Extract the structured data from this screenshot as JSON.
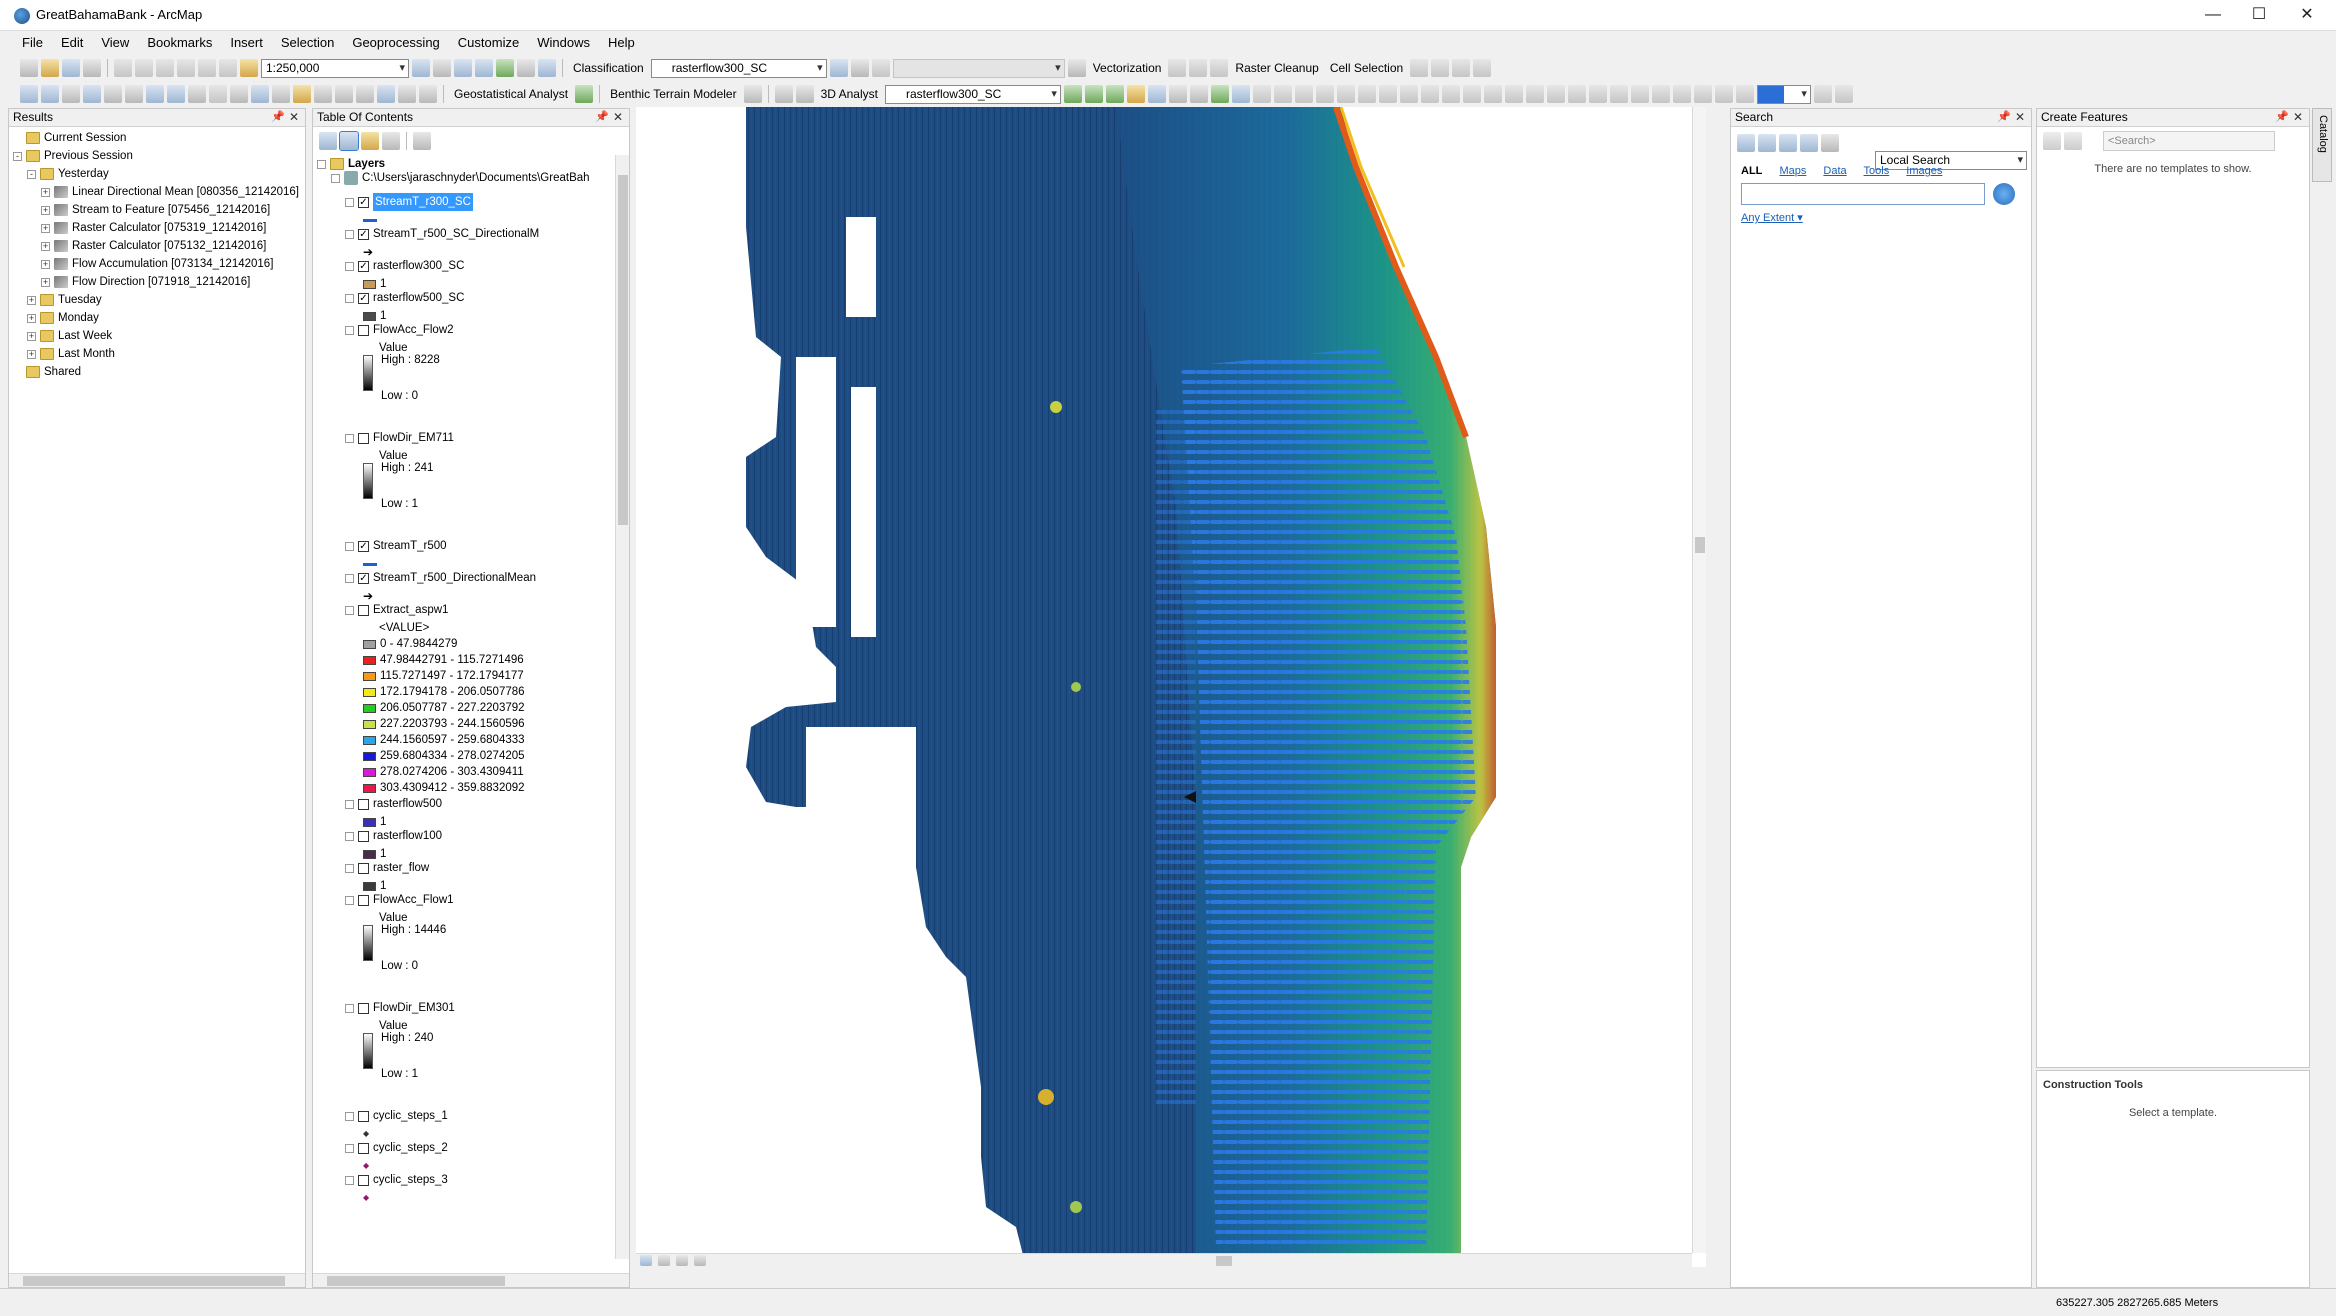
{
  "window": {
    "title": "GreatBahamaBank - ArcMap",
    "minimize": "—",
    "maximize": "☐",
    "close": "✕"
  },
  "menu": [
    "File",
    "Edit",
    "View",
    "Bookmarks",
    "Insert",
    "Selection",
    "Geoprocessing",
    "Customize",
    "Windows",
    "Help"
  ],
  "toolbar": {
    "scale": "1:250,000",
    "classification": "Classification",
    "classification_layer": "rasterflow300_SC",
    "vectorization": "Vectorization",
    "raster_cleanup": "Raster Cleanup",
    "cell_selection": "Cell Selection",
    "geostatistical": "Geostatistical Analyst",
    "benthic": "Benthic Terrain Modeler",
    "analyst3d": "3D Analyst",
    "analyst3d_layer": "rasterflow300_SC"
  },
  "results": {
    "title": "Results",
    "items": [
      {
        "label": "Current Session",
        "level": 0,
        "icon": "results"
      },
      {
        "label": "Previous Session",
        "level": 0,
        "icon": "results",
        "exp": "-"
      },
      {
        "label": "Yesterday",
        "level": 1,
        "icon": "results",
        "exp": "-"
      },
      {
        "label": "Linear Directional Mean [080356_12142016]",
        "level": 2,
        "icon": "tool",
        "exp": "+"
      },
      {
        "label": "Stream to Feature [075456_12142016]",
        "level": 2,
        "icon": "tool",
        "exp": "+"
      },
      {
        "label": "Raster Calculator [075319_12142016]",
        "level": 2,
        "icon": "tool",
        "exp": "+"
      },
      {
        "label": "Raster Calculator [075132_12142016]",
        "level": 2,
        "icon": "tool",
        "exp": "+"
      },
      {
        "label": "Flow Accumulation [073134_12142016]",
        "level": 2,
        "icon": "tool",
        "exp": "+"
      },
      {
        "label": "Flow Direction [071918_12142016]",
        "level": 2,
        "icon": "tool",
        "exp": "+"
      },
      {
        "label": "Tuesday",
        "level": 1,
        "icon": "results",
        "exp": "+"
      },
      {
        "label": "Monday",
        "level": 1,
        "icon": "results",
        "exp": "+"
      },
      {
        "label": "Last Week",
        "level": 1,
        "icon": "results",
        "exp": "+"
      },
      {
        "label": "Last Month",
        "level": 1,
        "icon": "results",
        "exp": "+"
      },
      {
        "label": "Shared",
        "level": 0,
        "icon": "results"
      }
    ]
  },
  "toc": {
    "title": "Table Of Contents",
    "layers_label": "Layers",
    "path": "C:\\Users\\jaraschnyder\\Documents\\GreatBah",
    "layers": [
      {
        "name": "StreamT_r300_SC",
        "checked": true,
        "selected": true,
        "legend": {
          "kind": "line",
          "color": "#1f5fd0"
        }
      },
      {
        "name": "StreamT_r500_SC_DirectionalM",
        "checked": true,
        "legend": {
          "kind": "arrow"
        }
      },
      {
        "name": "rasterflow300_SC",
        "checked": true,
        "legend": {
          "kind": "swatch",
          "color": "#c89a58",
          "label": "1"
        }
      },
      {
        "name": "rasterflow500_SC",
        "checked": true,
        "legend": {
          "kind": "swatch",
          "color": "#4a4a4a",
          "label": "1"
        }
      },
      {
        "name": "FlowAcc_Flow2",
        "checked": false,
        "legend": {
          "kind": "ramp",
          "title": "Value",
          "high": "High : 8228",
          "low": "Low : 0"
        }
      },
      {
        "name": "FlowDir_EM711",
        "checked": false,
        "legend": {
          "kind": "ramp",
          "title": "Value",
          "high": "High : 241",
          "low": "Low : 1"
        }
      },
      {
        "name": "StreamT_r500",
        "checked": true,
        "legend": {
          "kind": "line",
          "color": "#1f5fd0"
        }
      },
      {
        "name": "StreamT_r500_DirectionalMean",
        "checked": true,
        "legend": {
          "kind": "arrow"
        }
      },
      {
        "name": "Extract_aspw1",
        "checked": false,
        "legend": {
          "kind": "classes",
          "title": "<VALUE>",
          "classes": [
            {
              "label": "0 - 47.9844279",
              "color": "#a0a0a0"
            },
            {
              "label": "47.98442791 - 115.7271496",
              "color": "#e8201e"
            },
            {
              "label": "115.7271497 - 172.1794177",
              "color": "#f59a16"
            },
            {
              "label": "172.1794178 - 206.0507786",
              "color": "#f2ea18"
            },
            {
              "label": "206.0507787 - 227.2203792",
              "color": "#22cc22"
            },
            {
              "label": "227.2203793 - 244.1560596",
              "color": "#c8e04a"
            },
            {
              "label": "244.1560597 - 259.6804333",
              "color": "#2aa6e8"
            },
            {
              "label": "259.6804334 - 278.0274205",
              "color": "#1818d8"
            },
            {
              "label": "278.0274206 - 303.4309411",
              "color": "#d81ad8"
            },
            {
              "label": "303.4309412 - 359.8832092",
              "color": "#e8184a"
            }
          ]
        }
      },
      {
        "name": "rasterflow500",
        "checked": false,
        "legend": {
          "kind": "swatch",
          "color": "#3a2fb8",
          "label": "1"
        }
      },
      {
        "name": "rasterflow100",
        "checked": false,
        "legend": {
          "kind": "swatch",
          "color": "#4a2a4a",
          "label": "1"
        }
      },
      {
        "name": "raster_flow",
        "checked": false,
        "legend": {
          "kind": "swatch",
          "color": "#3a3a3a",
          "label": "1"
        }
      },
      {
        "name": "FlowAcc_Flow1",
        "checked": false,
        "legend": {
          "kind": "ramp",
          "title": "Value",
          "high": "High : 14446",
          "low": "Low : 0"
        }
      },
      {
        "name": "FlowDir_EM301",
        "checked": false,
        "legend": {
          "kind": "ramp",
          "title": "Value",
          "high": "High : 240",
          "low": "Low : 1"
        }
      },
      {
        "name": "cyclic_steps_1",
        "checked": false,
        "legend": {
          "kind": "dot",
          "color": "#333"
        }
      },
      {
        "name": "cyclic_steps_2",
        "checked": false,
        "legend": {
          "kind": "dot",
          "color": "#8a1a6a"
        }
      },
      {
        "name": "cyclic_steps_3",
        "checked": false,
        "legend": {
          "kind": "dot",
          "color": "#8a1a6a"
        }
      }
    ]
  },
  "search": {
    "title": "Search",
    "scope": "Local Search",
    "tabs": [
      "ALL",
      "Maps",
      "Data",
      "Tools",
      "Images"
    ],
    "extent": "Any Extent"
  },
  "create_features": {
    "title": "Create Features",
    "search_placeholder": "<Search>",
    "empty": "There are no templates to show.",
    "construction_title": "Construction Tools",
    "construction_msg": "Select a template."
  },
  "catalog_tab": "Catalog",
  "status": {
    "coords": "635227.305  2827265.685 Meters"
  }
}
